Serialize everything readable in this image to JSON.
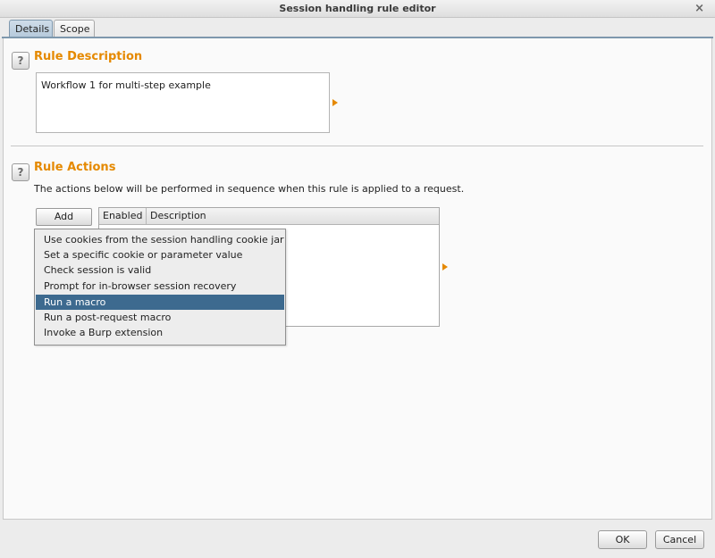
{
  "window": {
    "title": "Session handling rule editor",
    "close_glyph": "×"
  },
  "tabs": [
    {
      "label": "Details",
      "active": true
    },
    {
      "label": "Scope",
      "active": false
    }
  ],
  "rule_description": {
    "help_glyph": "?",
    "heading": "Rule Description",
    "value": "Workflow 1 for multi-step example"
  },
  "rule_actions": {
    "help_glyph": "?",
    "heading": "Rule Actions",
    "intro": "The actions below will be performed in sequence when this rule is applied to a request.",
    "add_label": "Add",
    "columns": [
      "Enabled",
      "Description"
    ],
    "menu_items": [
      {
        "label": "Use cookies from the session handling cookie jar",
        "selected": false
      },
      {
        "label": "Set a specific cookie or parameter value",
        "selected": false
      },
      {
        "label": "Check session is valid",
        "selected": false
      },
      {
        "label": "Prompt for in-browser session recovery",
        "selected": false
      },
      {
        "label": "Run a macro",
        "selected": true
      },
      {
        "label": "Run a post-request macro",
        "selected": false
      },
      {
        "label": "Invoke a Burp extension",
        "selected": false
      }
    ]
  },
  "footer": {
    "ok_label": "OK",
    "cancel_label": "Cancel"
  },
  "colors": {
    "accent": "#e58900",
    "selection": "#3d6a8f",
    "active_tab": "#b5c9db"
  }
}
